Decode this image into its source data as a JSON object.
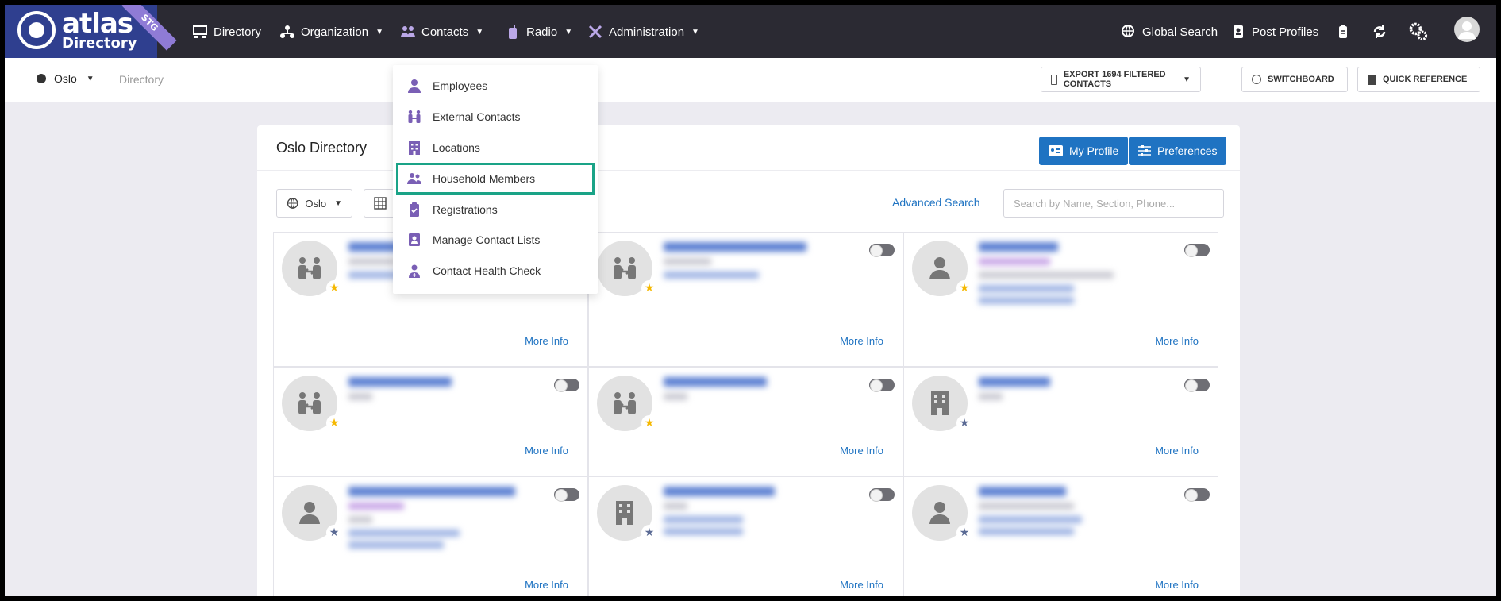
{
  "brand": {
    "name": "atlas",
    "sub": "Directory",
    "env": "STG"
  },
  "nav": {
    "directory": "Directory",
    "organization": "Organization",
    "contacts": "Contacts",
    "radio": "Radio",
    "administration": "Administration",
    "global_search": "Global Search",
    "post_profiles": "Post Profiles"
  },
  "subbar": {
    "location": "Oslo",
    "breadcrumb": "Directory",
    "export_label": "EXPORT 1694 FILTERED CONTACTS",
    "switchboard_label": "SWITCHBOARD",
    "quick_reference_label": "QUICK REFERENCE"
  },
  "card": {
    "title": "Oslo Directory",
    "my_profile": "My Profile",
    "preferences": "Preferences",
    "filter_location": "Oslo",
    "advanced_search": "Advanced Search",
    "search_placeholder": "Search by Name, Section, Phone..."
  },
  "contacts_menu": {
    "items": [
      {
        "label": "Employees",
        "icon": "person-icon"
      },
      {
        "label": "External Contacts",
        "icon": "handshake-icon"
      },
      {
        "label": "Locations",
        "icon": "building-icon"
      },
      {
        "label": "Household Members",
        "icon": "people-icon",
        "highlighted": true
      },
      {
        "label": "Registrations",
        "icon": "clipboard-check-icon"
      },
      {
        "label": "Manage Contact Lists",
        "icon": "contact-card-icon"
      },
      {
        "label": "Contact Health Check",
        "icon": "user-doctor-icon"
      }
    ]
  },
  "tiles": {
    "more_info": "More Info",
    "items": [
      {
        "avatar": "handshake-icon",
        "star": "gold"
      },
      {
        "avatar": "handshake-icon",
        "star": "gold"
      },
      {
        "avatar": "person-icon",
        "star": "gold"
      },
      {
        "avatar": "handshake-icon",
        "star": "gold"
      },
      {
        "avatar": "handshake-icon",
        "star": "gold"
      },
      {
        "avatar": "building-icon",
        "star": "blue"
      },
      {
        "avatar": "person-icon",
        "star": "blue"
      },
      {
        "avatar": "building-icon",
        "star": "blue"
      },
      {
        "avatar": "person-icon",
        "star": "blue"
      }
    ]
  },
  "colors": {
    "navbar": "#2b2a33",
    "accent_blue": "#1f73c2",
    "menu_icon": "#7a5fb5",
    "highlight": "#1aa387",
    "star_gold": "#f5b800"
  }
}
